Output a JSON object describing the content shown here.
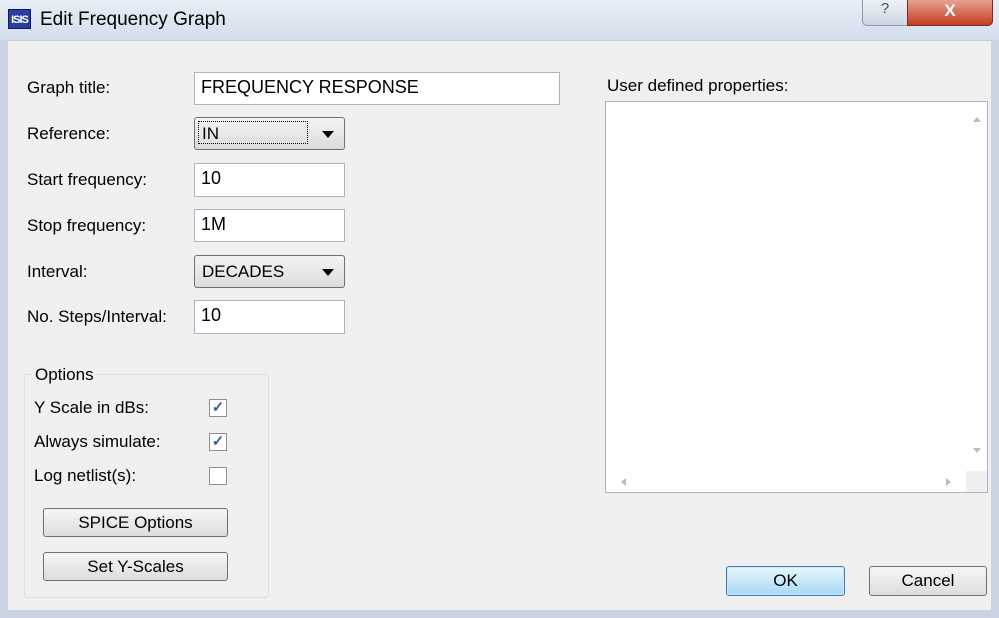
{
  "window": {
    "title": "Edit Frequency Graph",
    "app_icon_text": "ISIS",
    "help_glyph": "?",
    "close_glyph": "X"
  },
  "fields": {
    "graph_title": {
      "label": "Graph title:",
      "value": "FREQUENCY RESPONSE"
    },
    "reference": {
      "label": "Reference:",
      "value": "IN"
    },
    "start_frequency": {
      "label": "Start frequency:",
      "value": "10"
    },
    "stop_frequency": {
      "label": "Stop frequency:",
      "value": "1M"
    },
    "interval": {
      "label": "Interval:",
      "value": "DECADES"
    },
    "steps_per_interval": {
      "label": "No. Steps/Interval:",
      "value": "10"
    }
  },
  "options": {
    "group_label": "Options",
    "y_scale_db": {
      "label": "Y Scale in dBs:",
      "checked": true
    },
    "always_simulate": {
      "label": "Always simulate:",
      "checked": true
    },
    "log_netlists": {
      "label": "Log netlist(s):",
      "checked": false
    },
    "spice_options_label": "SPICE Options",
    "set_y_scales_label": "Set Y-Scales"
  },
  "properties": {
    "label": "User defined properties:"
  },
  "buttons": {
    "ok": "OK",
    "cancel": "Cancel"
  },
  "icons": {
    "check": "✓",
    "scroll_up": "scroll-up-arrow",
    "scroll_down": "scroll-down-arrow",
    "scroll_left": "scroll-left-arrow",
    "scroll_right": "scroll-right-arrow"
  },
  "colors": {
    "app_icon_bg": "#2a3e9c",
    "close_button": "#c43c22",
    "default_button_border": "#3c7fb1",
    "dialog_bg": "#f0f0f0"
  }
}
